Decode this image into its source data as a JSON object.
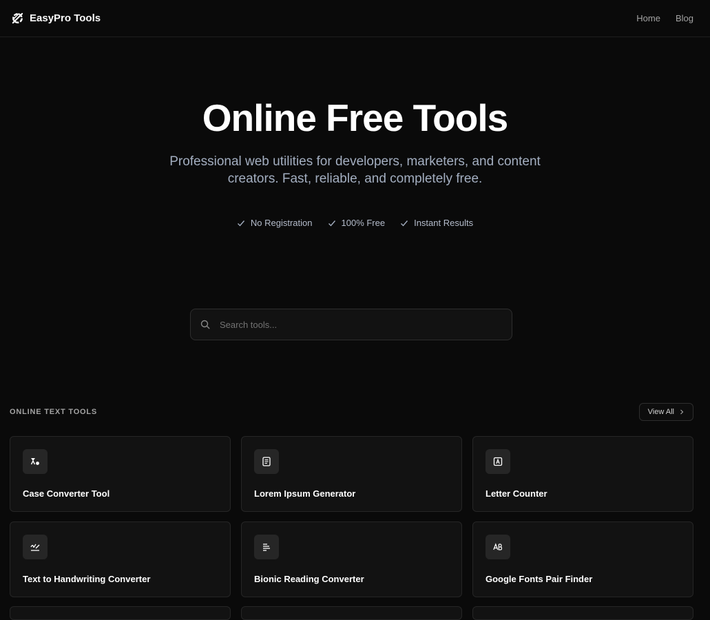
{
  "navbar": {
    "brand": "EasyPro Tools",
    "links": [
      {
        "label": "Home",
        "icon": "none"
      },
      {
        "label": "Blog",
        "icon": "none"
      }
    ]
  },
  "hero": {
    "title": "Online Free Tools",
    "subtitle": "Professional web utilities for developers, marketers, and content creators. Fast, reliable, and completely free.",
    "features": [
      "No Registration",
      "100% Free",
      "Instant Results"
    ]
  },
  "search": {
    "placeholder": "Search tools...",
    "value": ""
  },
  "section": {
    "title": "ONLINE TEXT TOOLS",
    "view_all_label": "View All"
  },
  "tools": [
    {
      "name": "Case Converter Tool",
      "icon": "case-converter-icon"
    },
    {
      "name": "Lorem Ipsum Generator",
      "icon": "document-text-icon"
    },
    {
      "name": "Letter Counter",
      "icon": "letter-square-icon"
    },
    {
      "name": "Text to Handwriting Converter",
      "icon": "handwriting-icon"
    },
    {
      "name": "Bionic Reading Converter",
      "icon": "text-lines-icon"
    },
    {
      "name": "Google Fonts Pair Finder",
      "icon": "font-pair-icon"
    }
  ],
  "colors": {
    "background": "#0a0a0a",
    "card": "#121212",
    "border": "#262626",
    "text": "#fafafa",
    "muted": "#a3aec0"
  }
}
